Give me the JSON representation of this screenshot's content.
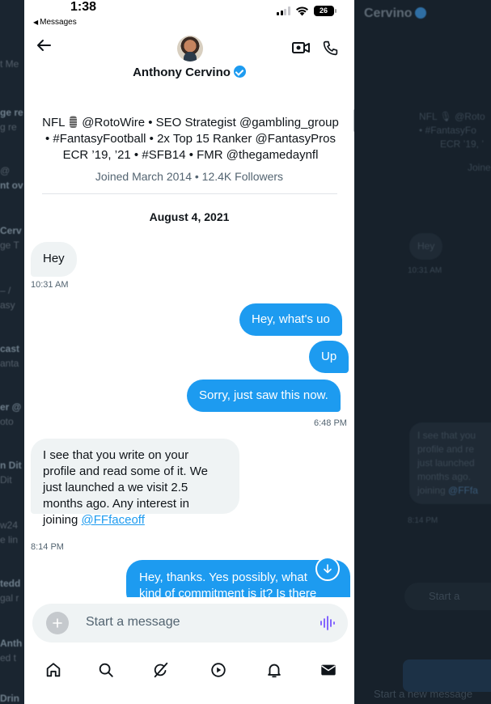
{
  "status_bar": {
    "time": "1:38",
    "back_label": "Messages",
    "battery": "26"
  },
  "header": {
    "name": "Anthony Cervino"
  },
  "profile": {
    "bio_lines": [
      "NFL 🎙 @RotoWire • SEO Strategist @gambling_group",
      "• #FantasyFootball • 2x Top 15 Ranker @FantasyPros",
      "ECR ’19, ’21 • #SFB14 • FMR @thegamedaynfl"
    ],
    "joined": "Joined March 2014 • 12.4K Followers"
  },
  "conversation": {
    "date": "August 4, 2021",
    "messages": [
      {
        "direction": "in",
        "text": "Hey",
        "time": "10:31 AM"
      },
      {
        "direction": "out",
        "text": "Hey, what's uo"
      },
      {
        "direction": "out",
        "text": "Up"
      },
      {
        "direction": "out",
        "text": "Sorry, just saw this now.",
        "time": "6:48 PM"
      },
      {
        "direction": "in",
        "lines": [
          "I see that you write on your",
          "profile and read some of it. We",
          "just launched a we visit 2.5",
          "months ago. Any interest in",
          "joining "
        ],
        "link": "@FFfaceoff",
        "time": "8:14 PM"
      },
      {
        "direction": "out",
        "lines": [
          "Hey, thanks. Yes possibly, what",
          "kind of commitment is it? Is there"
        ]
      }
    ]
  },
  "composer": {
    "placeholder": "Start a message"
  },
  "tabbar": {
    "items": [
      "home-icon",
      "search-icon",
      "grok-icon",
      "video-icon",
      "notifications-icon",
      "messages-icon"
    ]
  },
  "background": {
    "title": "Cervino",
    "ghost_bio": [
      "NFL 🎙 @Roto",
      "• #FantasyFo",
      "ECR ’19, ’",
      "Joine"
    ],
    "ghost_hey": "Hey",
    "ghost_hey_time": "10:31 AM",
    "ghost_message": [
      "I see that you",
      "profile and re",
      "just launched",
      "months ago.",
      "joining "
    ],
    "ghost_link": "@FFfa",
    "ghost_time": "8:14 PM",
    "ghost_input": "Start a",
    "ghost_start": "Start a new message",
    "left_snippets": [
      "t Me",
      "ge re",
      "g re",
      "@",
      "nt ov",
      "Cerv",
      "ge T",
      "– /",
      "asy",
      "cast",
      "anta",
      "er @",
      "oto",
      "n Dit",
      "Dit",
      "w24",
      "e lin",
      "tedd",
      "gal r",
      "Anth",
      "ed t",
      "Drin"
    ]
  },
  "colors": {
    "accent": "#1d9bf0",
    "incoming_bubble": "#eff3f4",
    "text": "#0f1419",
    "muted": "#536471"
  }
}
